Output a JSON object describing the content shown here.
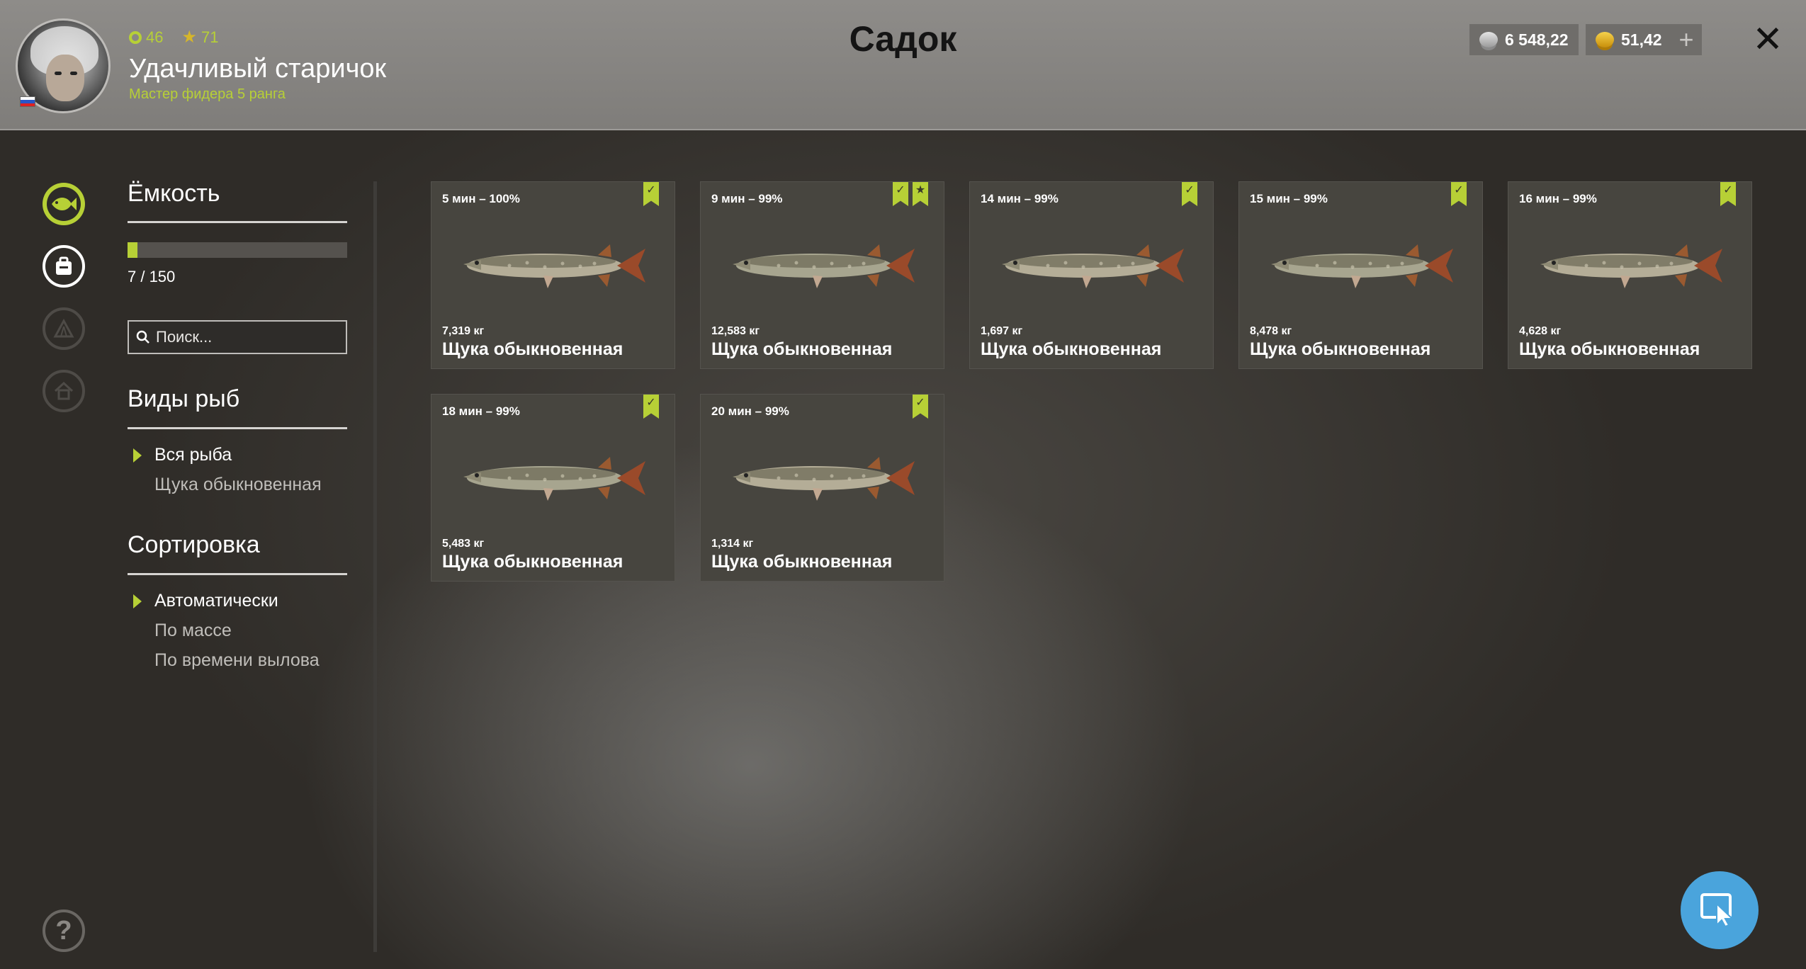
{
  "header": {
    "title": "Садок",
    "player": {
      "name": "Удачливый старичок",
      "rank": "Мастер фидера 5 ранга",
      "level": "46",
      "stars": "71"
    },
    "currency": {
      "silver": "6 548,22",
      "gold": "51,42",
      "add_label": "+"
    },
    "close_label": "✕"
  },
  "sidebar": {
    "capacity": {
      "title": "Ёмкость",
      "used": 7,
      "total": 150,
      "text": "7 / 150"
    },
    "search": {
      "placeholder": "Поиск..."
    },
    "species": {
      "title": "Виды рыб",
      "options": [
        "Вся рыба",
        "Щука обыкновенная"
      ],
      "selected": "Вся рыба"
    },
    "sorting": {
      "title": "Сортировка",
      "options": [
        "Автоматически",
        "По массе",
        "По времени вылова"
      ],
      "selected": "Автоматически"
    },
    "help_label": "?"
  },
  "fish": [
    {
      "time": "5 мин – 100%",
      "weight": "7,319 кг",
      "name": "Щука обыкновенная",
      "badges": [
        "check"
      ]
    },
    {
      "time": "9 мин – 99%",
      "weight": "12,583 кг",
      "name": "Щука обыкновенная",
      "badges": [
        "check",
        "star"
      ]
    },
    {
      "time": "14 мин – 99%",
      "weight": "1,697 кг",
      "name": "Щука обыкновенная",
      "badges": [
        "check"
      ]
    },
    {
      "time": "15 мин – 99%",
      "weight": "8,478 кг",
      "name": "Щука обыкновенная",
      "badges": [
        "check"
      ]
    },
    {
      "time": "16 мин – 99%",
      "weight": "4,628 кг",
      "name": "Щука обыкновенная",
      "badges": [
        "check"
      ]
    },
    {
      "time": "18 мин – 99%",
      "weight": "5,483 кг",
      "name": "Щука обыкновенная",
      "badges": [
        "check"
      ]
    },
    {
      "time": "20 мин – 99%",
      "weight": "1,314 кг",
      "name": "Щука обыкновенная",
      "badges": [
        "check"
      ]
    }
  ],
  "colors": {
    "accent": "#b7d036",
    "header_bg": "#8e8c89",
    "card_bg": "#47453f",
    "fab": "#4aa4dc"
  }
}
